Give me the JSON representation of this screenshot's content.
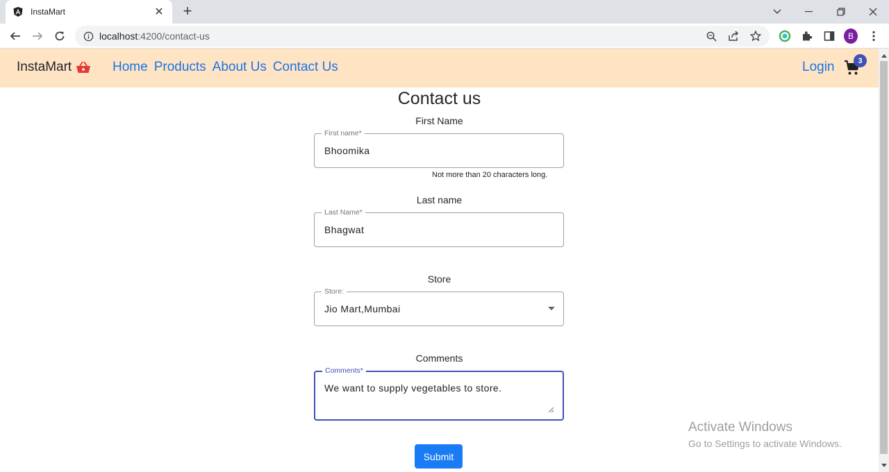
{
  "browser": {
    "tab_title": "InstaMart",
    "url_host": "localhost",
    "url_rest": ":4200/contact-us",
    "profile_initial": "B"
  },
  "header": {
    "brand": "InstaMart",
    "nav": [
      "Home",
      "Products",
      "About Us",
      "Contact Us"
    ],
    "login": "Login",
    "cart_count": "3",
    "bg_color": "#ffe4c4",
    "link_color": "#1a73e8"
  },
  "form": {
    "title": "Contact us",
    "first_name": {
      "section_label": "First Name",
      "legend": "First name*",
      "value": "Bhoomika",
      "hint": "Not more than 20 characters long."
    },
    "last_name": {
      "section_label": "Last name",
      "legend": "Last Name*",
      "value": "Bhagwat"
    },
    "store": {
      "section_label": "Store",
      "legend": "Store:",
      "value": "Jio Mart,Mumbai"
    },
    "comments": {
      "section_label": "Comments",
      "legend": "Comments*",
      "value": "We want to supply vegetables to store."
    },
    "submit_label": "Submit",
    "submit_color": "#1a7cf5"
  },
  "watermark": {
    "title": "Activate Windows",
    "subtitle": "Go to Settings to activate Windows."
  }
}
